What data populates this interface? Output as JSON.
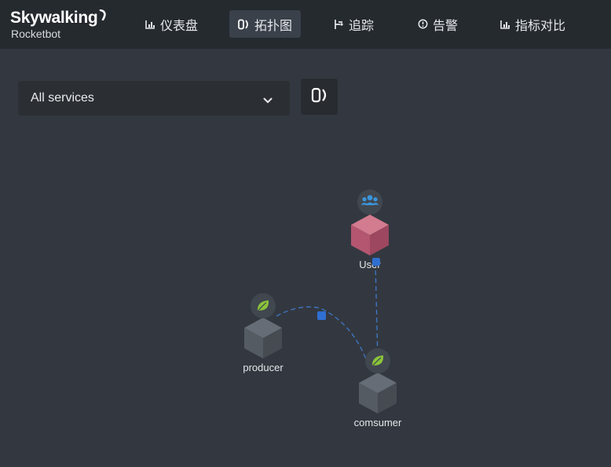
{
  "app": {
    "brand": "Skywalking",
    "subtitle": "Rocketbot"
  },
  "nav": [
    {
      "label": "仪表盘",
      "icon": "bar-chart-icon",
      "active": false
    },
    {
      "label": "拓扑图",
      "icon": "topology-icon",
      "active": true
    },
    {
      "label": "追踪",
      "icon": "trace-icon",
      "active": false
    },
    {
      "label": "告警",
      "icon": "alarm-icon",
      "active": false
    },
    {
      "label": "指标对比",
      "icon": "bar-chart-icon",
      "active": false
    }
  ],
  "toolbar": {
    "service_select_value": "All services",
    "toggle_icon": "topology-icon"
  },
  "topology": {
    "nodes": [
      {
        "id": "user",
        "label": "User",
        "type": "user",
        "badge_icon": "users-icon",
        "color": "#b85c72"
      },
      {
        "id": "producer",
        "label": "producer",
        "type": "service",
        "badge_icon": "spring-leaf-icon",
        "color": "#535961"
      },
      {
        "id": "comsumer",
        "label": "comsumer",
        "type": "service",
        "badge_icon": "spring-leaf-icon",
        "color": "#535961"
      }
    ],
    "edges": [
      {
        "from": "user",
        "to": "comsumer"
      },
      {
        "from": "producer",
        "to": "comsumer"
      }
    ],
    "colors": {
      "edge": "#3f78c8",
      "edge_marker": "#2f6fd0",
      "badge_bg": "#41474f",
      "spring_icon": "#8ac43a",
      "user_icon": "#3a94db"
    }
  }
}
